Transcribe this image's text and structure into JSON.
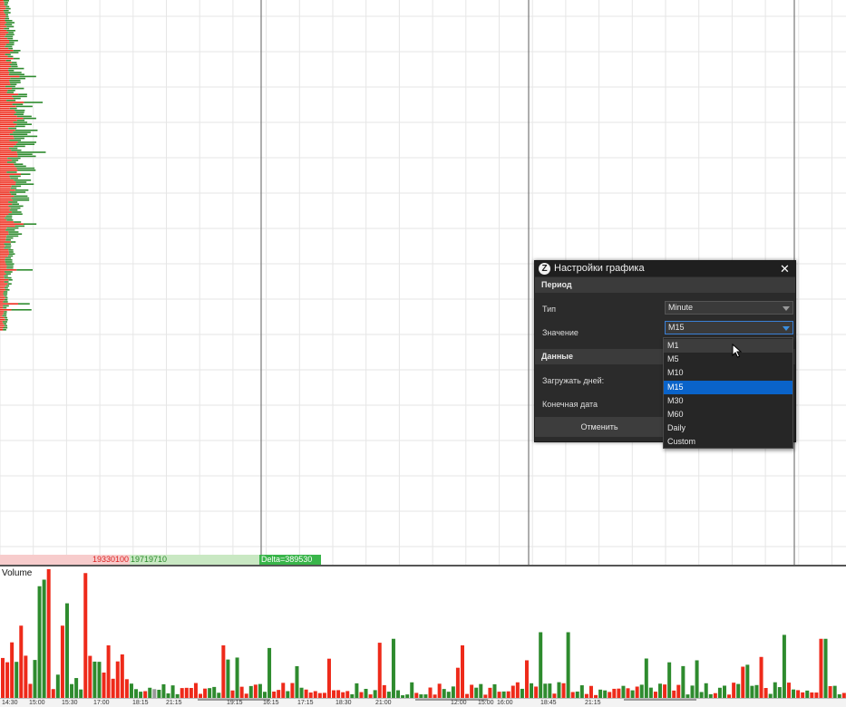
{
  "stats": {
    "sell_volume": "19330100",
    "buy_volume": "19719710",
    "delta": "Delta=389530"
  },
  "volume_panel": {
    "label": "Volume"
  },
  "time_axis": {
    "labels": [
      "14:30",
      "15:00",
      "15:30",
      "17:00",
      "18:15",
      "21:15",
      "",
      "19:15",
      "16:15",
      "17:15",
      "18:30",
      "21:00",
      "",
      "12:00",
      "15:00",
      "16:00",
      "18:45",
      "21:15",
      ""
    ]
  },
  "dialog": {
    "title": "Настройки графика",
    "close_glyph": "✕",
    "logo_glyph": "Z",
    "section_period": "Период",
    "type_label": "Тип",
    "type_value": "Minute",
    "value_label": "Значение",
    "value_value": "M15",
    "section_data": "Данные",
    "load_days_label": "Загружать дней:",
    "end_date_label": "Конечная дата",
    "cancel_button": "Отменить"
  },
  "dropdown": {
    "options": [
      "M1",
      "M5",
      "M10",
      "M15",
      "M30",
      "M60",
      "Daily",
      "Custom"
    ],
    "selected": "M15",
    "hovered": "M1"
  },
  "colors": {
    "buy": "#2e8b2e",
    "sell": "#ee2a1a",
    "neutral": "#999999",
    "grid": "#e6e6e6",
    "accent": "#0a63c9"
  }
}
